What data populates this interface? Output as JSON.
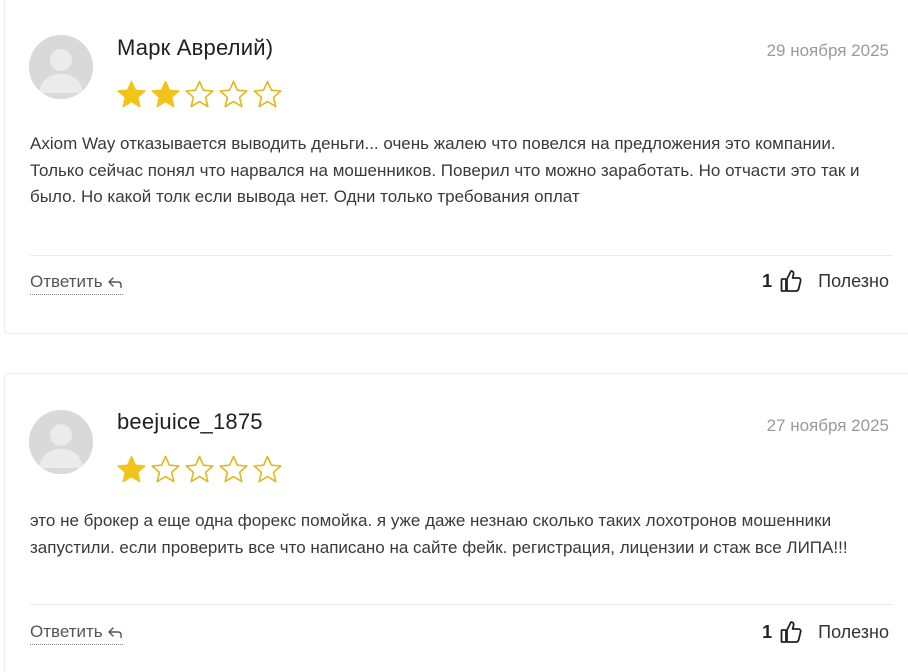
{
  "colors": {
    "star_filled": "#f2c41b",
    "star_empty_outline": "#e0b81c",
    "avatar_bg": "#d9d9d9",
    "date_text": "#9a9a9a"
  },
  "reviews": [
    {
      "author": "Марк Аврелий)",
      "date": "29 ноября 2025",
      "rating": 2,
      "rating_max": 5,
      "text": "Axiom Way отказывается выводить деньги... очень жалею что повелся на предложения это компании. Только сейчас понял что нарвался на мошенников. Поверил что можно заработать. Но отчасти это так и было. Но какой толк если вывода нет. Одни только требования оплат",
      "reply_label": "Ответить",
      "reply_icon": "reply-arrow-icon",
      "helpful_count": "1",
      "helpful_icon": "thumbs-up-icon",
      "helpful_label": "Полезно"
    },
    {
      "author": "beejuice_1875",
      "date": "27 ноября 2025",
      "rating": 1,
      "rating_max": 5,
      "text": "это не брокер а еще одна форекс помойка. я уже даже незнаю сколько таких лохотронов мошенники запустили. если проверить все что написано на сайте фейк. регистрация, лицензии и стаж все ЛИПА!!!",
      "reply_label": "Ответить",
      "reply_icon": "reply-arrow-icon",
      "helpful_count": "1",
      "helpful_icon": "thumbs-up-icon",
      "helpful_label": "Полезно"
    }
  ]
}
